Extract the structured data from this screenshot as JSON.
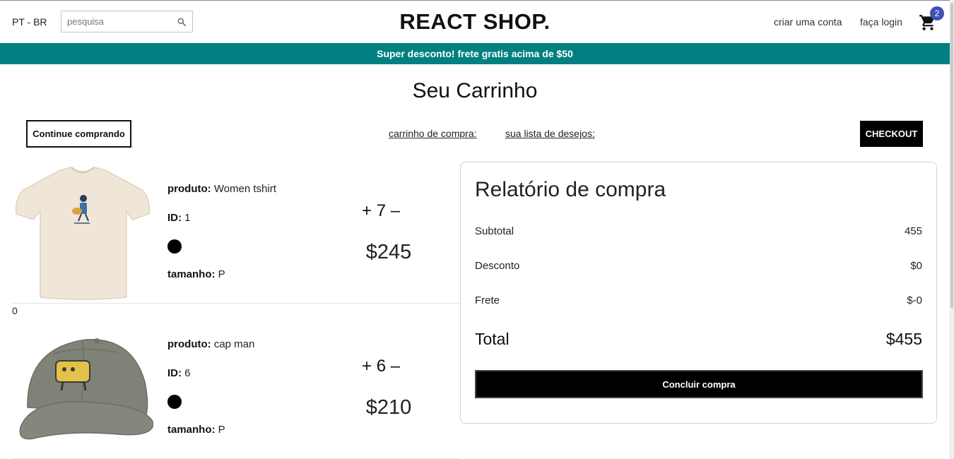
{
  "nav": {
    "language": "PT - BR",
    "search_placeholder": "pesquisa",
    "logo": "REACT SHOP.",
    "create_account": "criar uma conta",
    "login": "faça login",
    "cart_count": "2"
  },
  "promo": "Super desconto! frete gratis acima de $50",
  "page_title": "Seu Carrinho",
  "actions": {
    "continue_label": "Continue comprando",
    "cart_link": "carrinho de compra: ",
    "wishlist_link": "sua lista de desejos: ",
    "checkout_label": "CHECKOUT"
  },
  "products": [
    {
      "product_label": "produto:",
      "name": "Women tshirt",
      "id_label": "ID:",
      "id": "1",
      "color": "#000000",
      "size_label": "tamanho:",
      "size": "P",
      "plus": "+",
      "quantity": "7",
      "minus": "–",
      "price": "$245"
    },
    {
      "product_label": "produto:",
      "name": "cap man",
      "id_label": "ID:",
      "id": "6",
      "color": "#000000",
      "size_label": "tamanho:",
      "size": "P",
      "plus": "+",
      "quantity": "6",
      "minus": "–",
      "price": "$210"
    }
  ],
  "stray_value": "0",
  "summary": {
    "title": "Relatório de compra",
    "subtotal_label": "Subtotal",
    "subtotal_value": "455",
    "discount_label": "Desconto",
    "discount_value": "$0",
    "shipping_label": "Frete",
    "shipping_value": "$-0",
    "total_label": "Total",
    "total_value": "$455",
    "finish_label": "Concluir compra"
  },
  "colors": {
    "promo_bg": "#008080",
    "badge_bg": "#3f51b5",
    "button_bg": "#000000"
  }
}
